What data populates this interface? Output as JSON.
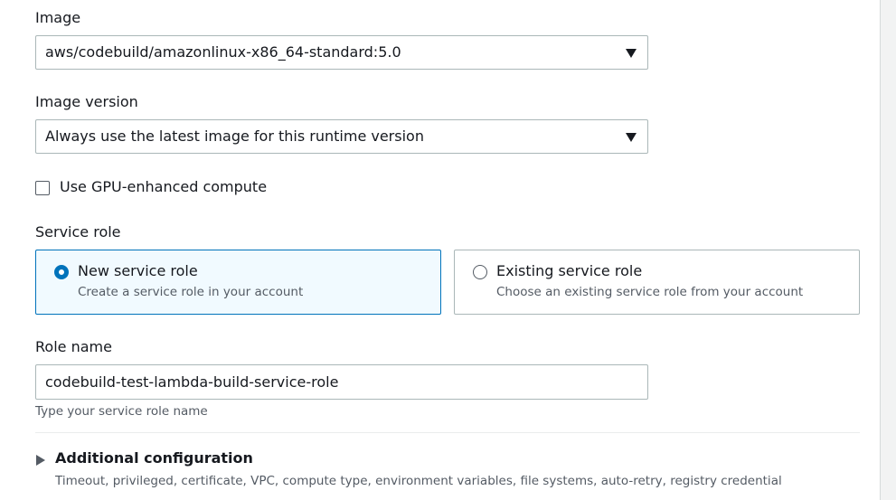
{
  "image": {
    "label": "Image",
    "selected": "aws/codebuild/amazonlinux-x86_64-standard:5.0"
  },
  "image_version": {
    "label": "Image version",
    "selected": "Always use the latest image for this runtime version"
  },
  "gpu": {
    "label": "Use GPU-enhanced compute",
    "checked": false
  },
  "service_role": {
    "label": "Service role",
    "options": [
      {
        "title": "New service role",
        "description": "Create a service role in your account",
        "selected": true
      },
      {
        "title": "Existing service role",
        "description": "Choose an existing service role from your account",
        "selected": false
      }
    ]
  },
  "role_name": {
    "label": "Role name",
    "value": "codebuild-test-lambda-build-service-role",
    "hint": "Type your service role name"
  },
  "additional_config": {
    "title": "Additional configuration",
    "description": "Timeout, privileged, certificate, VPC, compute type, environment variables, file systems, auto-retry, registry credential"
  },
  "colors": {
    "accent": "#0073bb",
    "selected_bg": "#f1faff",
    "border": "#aab7b8",
    "text": "#16191f",
    "muted_text": "#545b64"
  },
  "icons": {
    "dropdown": "caret-down-icon",
    "expander": "caret-right-icon"
  }
}
